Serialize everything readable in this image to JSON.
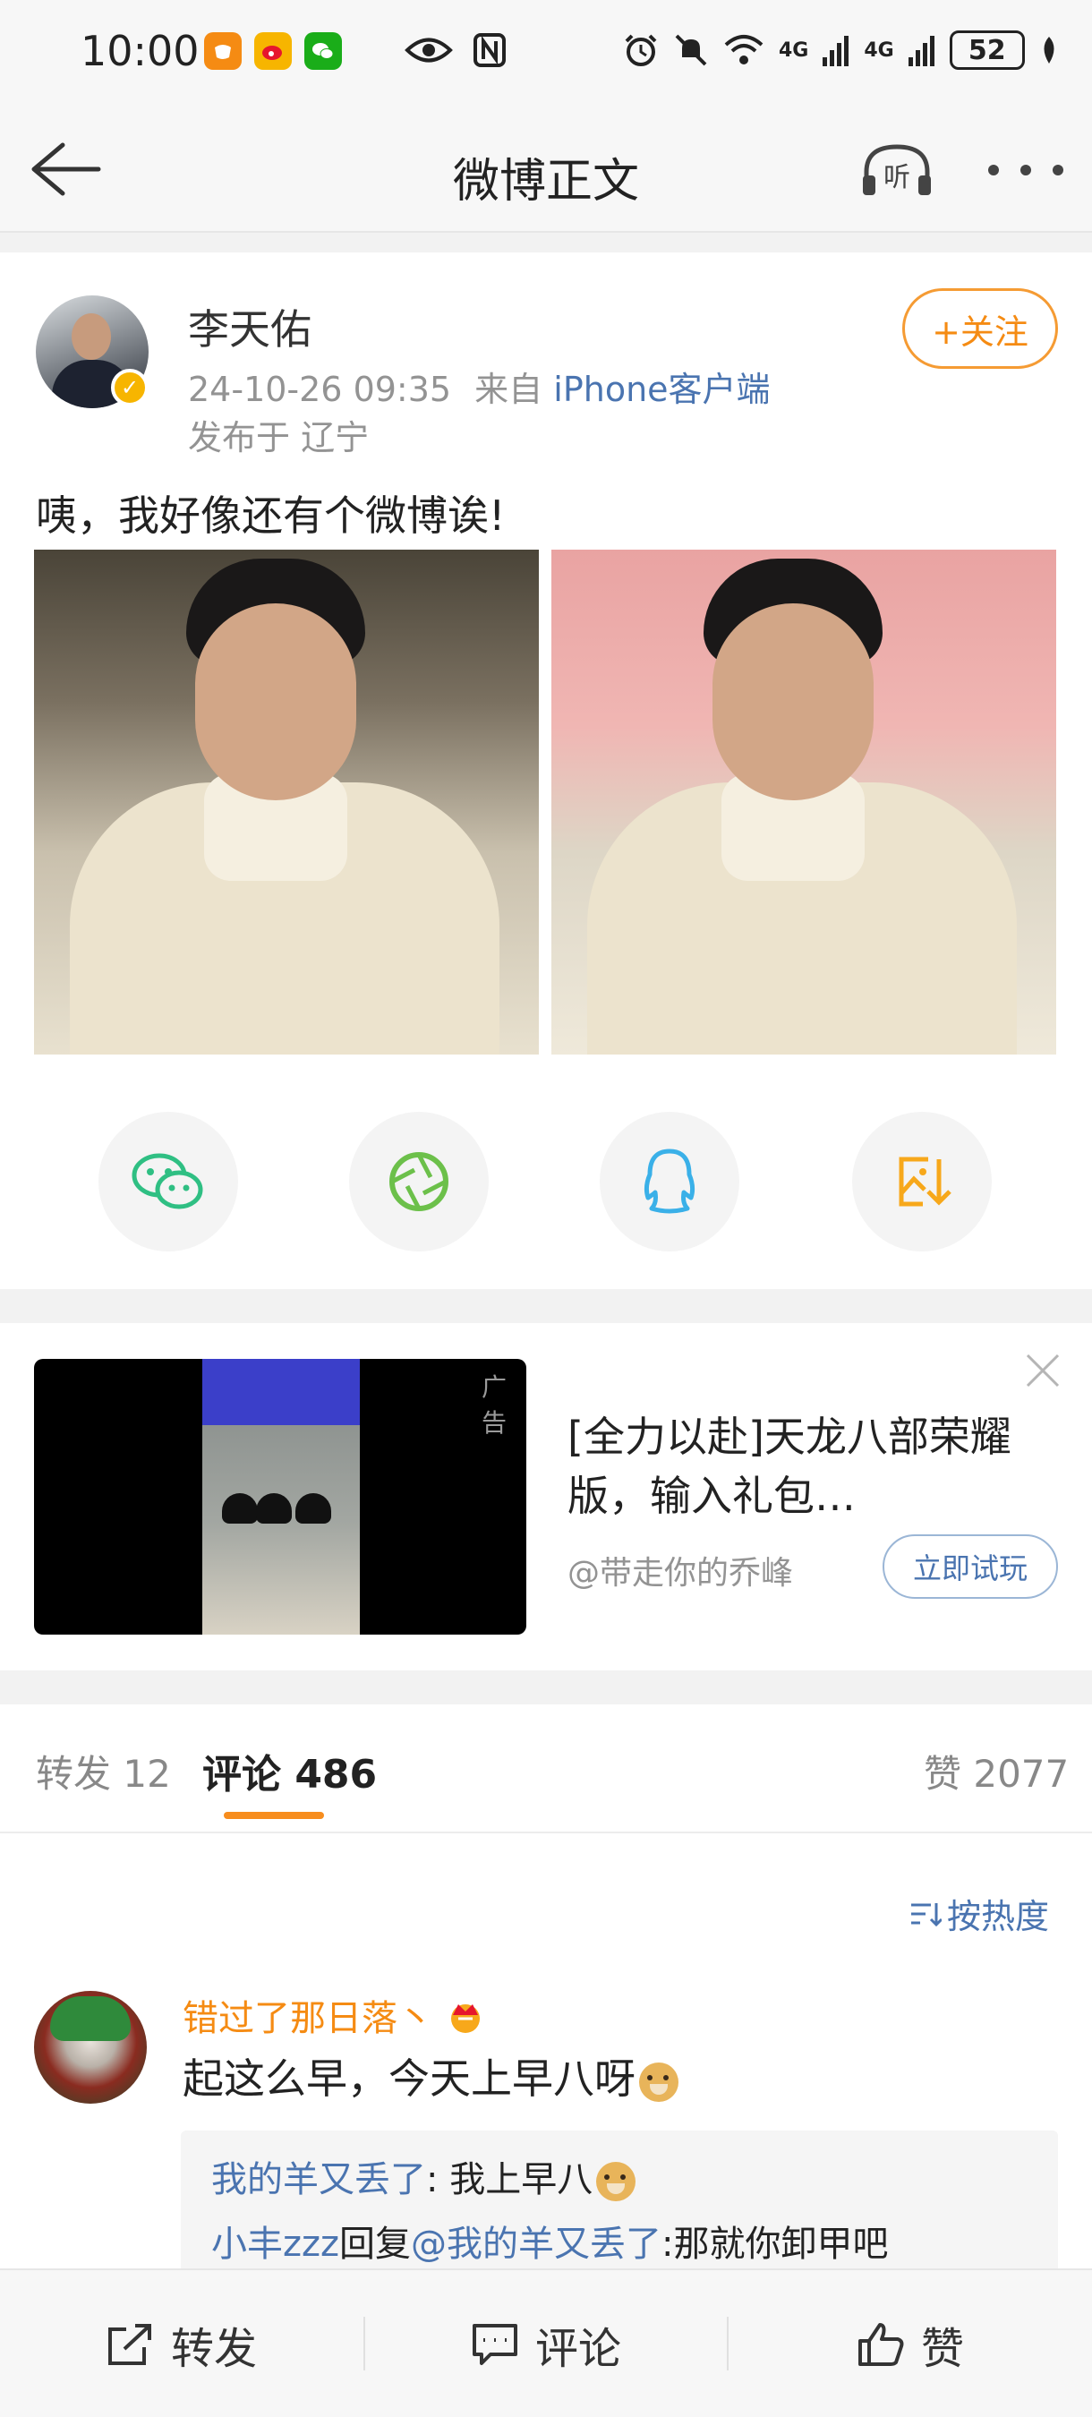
{
  "status_bar": {
    "time": "10:00",
    "network_1": "4G",
    "network_2": "4G",
    "battery": "52"
  },
  "nav": {
    "title": "微博正文",
    "listen_label": "听"
  },
  "post": {
    "author": "李天佑",
    "timestamp": "24-10-26 09:35",
    "source_prefix": "来自",
    "source": "iPhone客户端",
    "location": "发布于 辽宁",
    "follow_label": "+关注",
    "text": "咦，我好像还有个微博诶!"
  },
  "ad": {
    "tag": "广告",
    "title": "[全力以赴]天龙八部荣耀版，输入礼包…",
    "account": "@带走你的乔峰",
    "cta": "立即试玩"
  },
  "tabs": {
    "repost": "转发 12",
    "comments": "评论 486",
    "likes": "赞 2077"
  },
  "sort_label": "按热度",
  "comment": {
    "author": "错过了那日落丶",
    "text": "起这么早，今天上早八呀",
    "replies": [
      {
        "user": "我的羊又丢了",
        "text": ": 我上早八"
      },
      {
        "user": "小丰zzz",
        "mid": "回复",
        "mention": "@我的羊又丢了",
        "text": ":那就你卸甲吧"
      }
    ]
  },
  "bottom_bar": {
    "repost": "转发",
    "comment": "评论",
    "like": "赞"
  },
  "colors": {
    "accent_orange": "#f58b13",
    "link_blue": "#4a74b0",
    "verify_gold": "#f7b500"
  }
}
